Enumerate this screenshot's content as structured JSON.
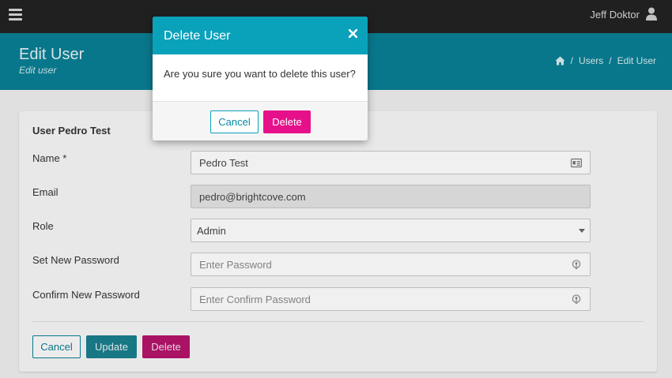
{
  "topbar": {
    "user_name": "Jeff Doktor",
    "menu_icon": "hamburger-icon",
    "user_icon": "user-icon"
  },
  "header": {
    "title": "Edit User",
    "subtitle": "Edit user",
    "breadcrumb": {
      "home_icon": "home-icon",
      "separator": "/",
      "items": [
        "Users",
        "Edit User"
      ]
    }
  },
  "form": {
    "card_title": "User Pedro Test",
    "name": {
      "label": "Name *",
      "value": "Pedro Test",
      "icon": "id-card-icon"
    },
    "email": {
      "label": "Email",
      "value": "pedro@brightcove.com"
    },
    "role": {
      "label": "Role",
      "value": "Admin"
    },
    "new_password": {
      "label": "Set New Password",
      "placeholder": "Enter Password",
      "icon": "key-icon"
    },
    "confirm_password": {
      "label": "Confirm New Password",
      "placeholder": "Enter Confirm Password",
      "icon": "key-icon"
    },
    "buttons": {
      "cancel": "Cancel",
      "update": "Update",
      "delete": "Delete"
    }
  },
  "modal": {
    "title": "Delete User",
    "message": "Are you sure you want to delete this user?",
    "cancel_label": "Cancel",
    "delete_label": "Delete",
    "close_icon": "close-icon"
  },
  "colors": {
    "topbar": "#222222",
    "header": "#0a7f94",
    "modal_header": "#0aa2bb",
    "delete": "#e6118a",
    "accent": "#0a7f94"
  }
}
